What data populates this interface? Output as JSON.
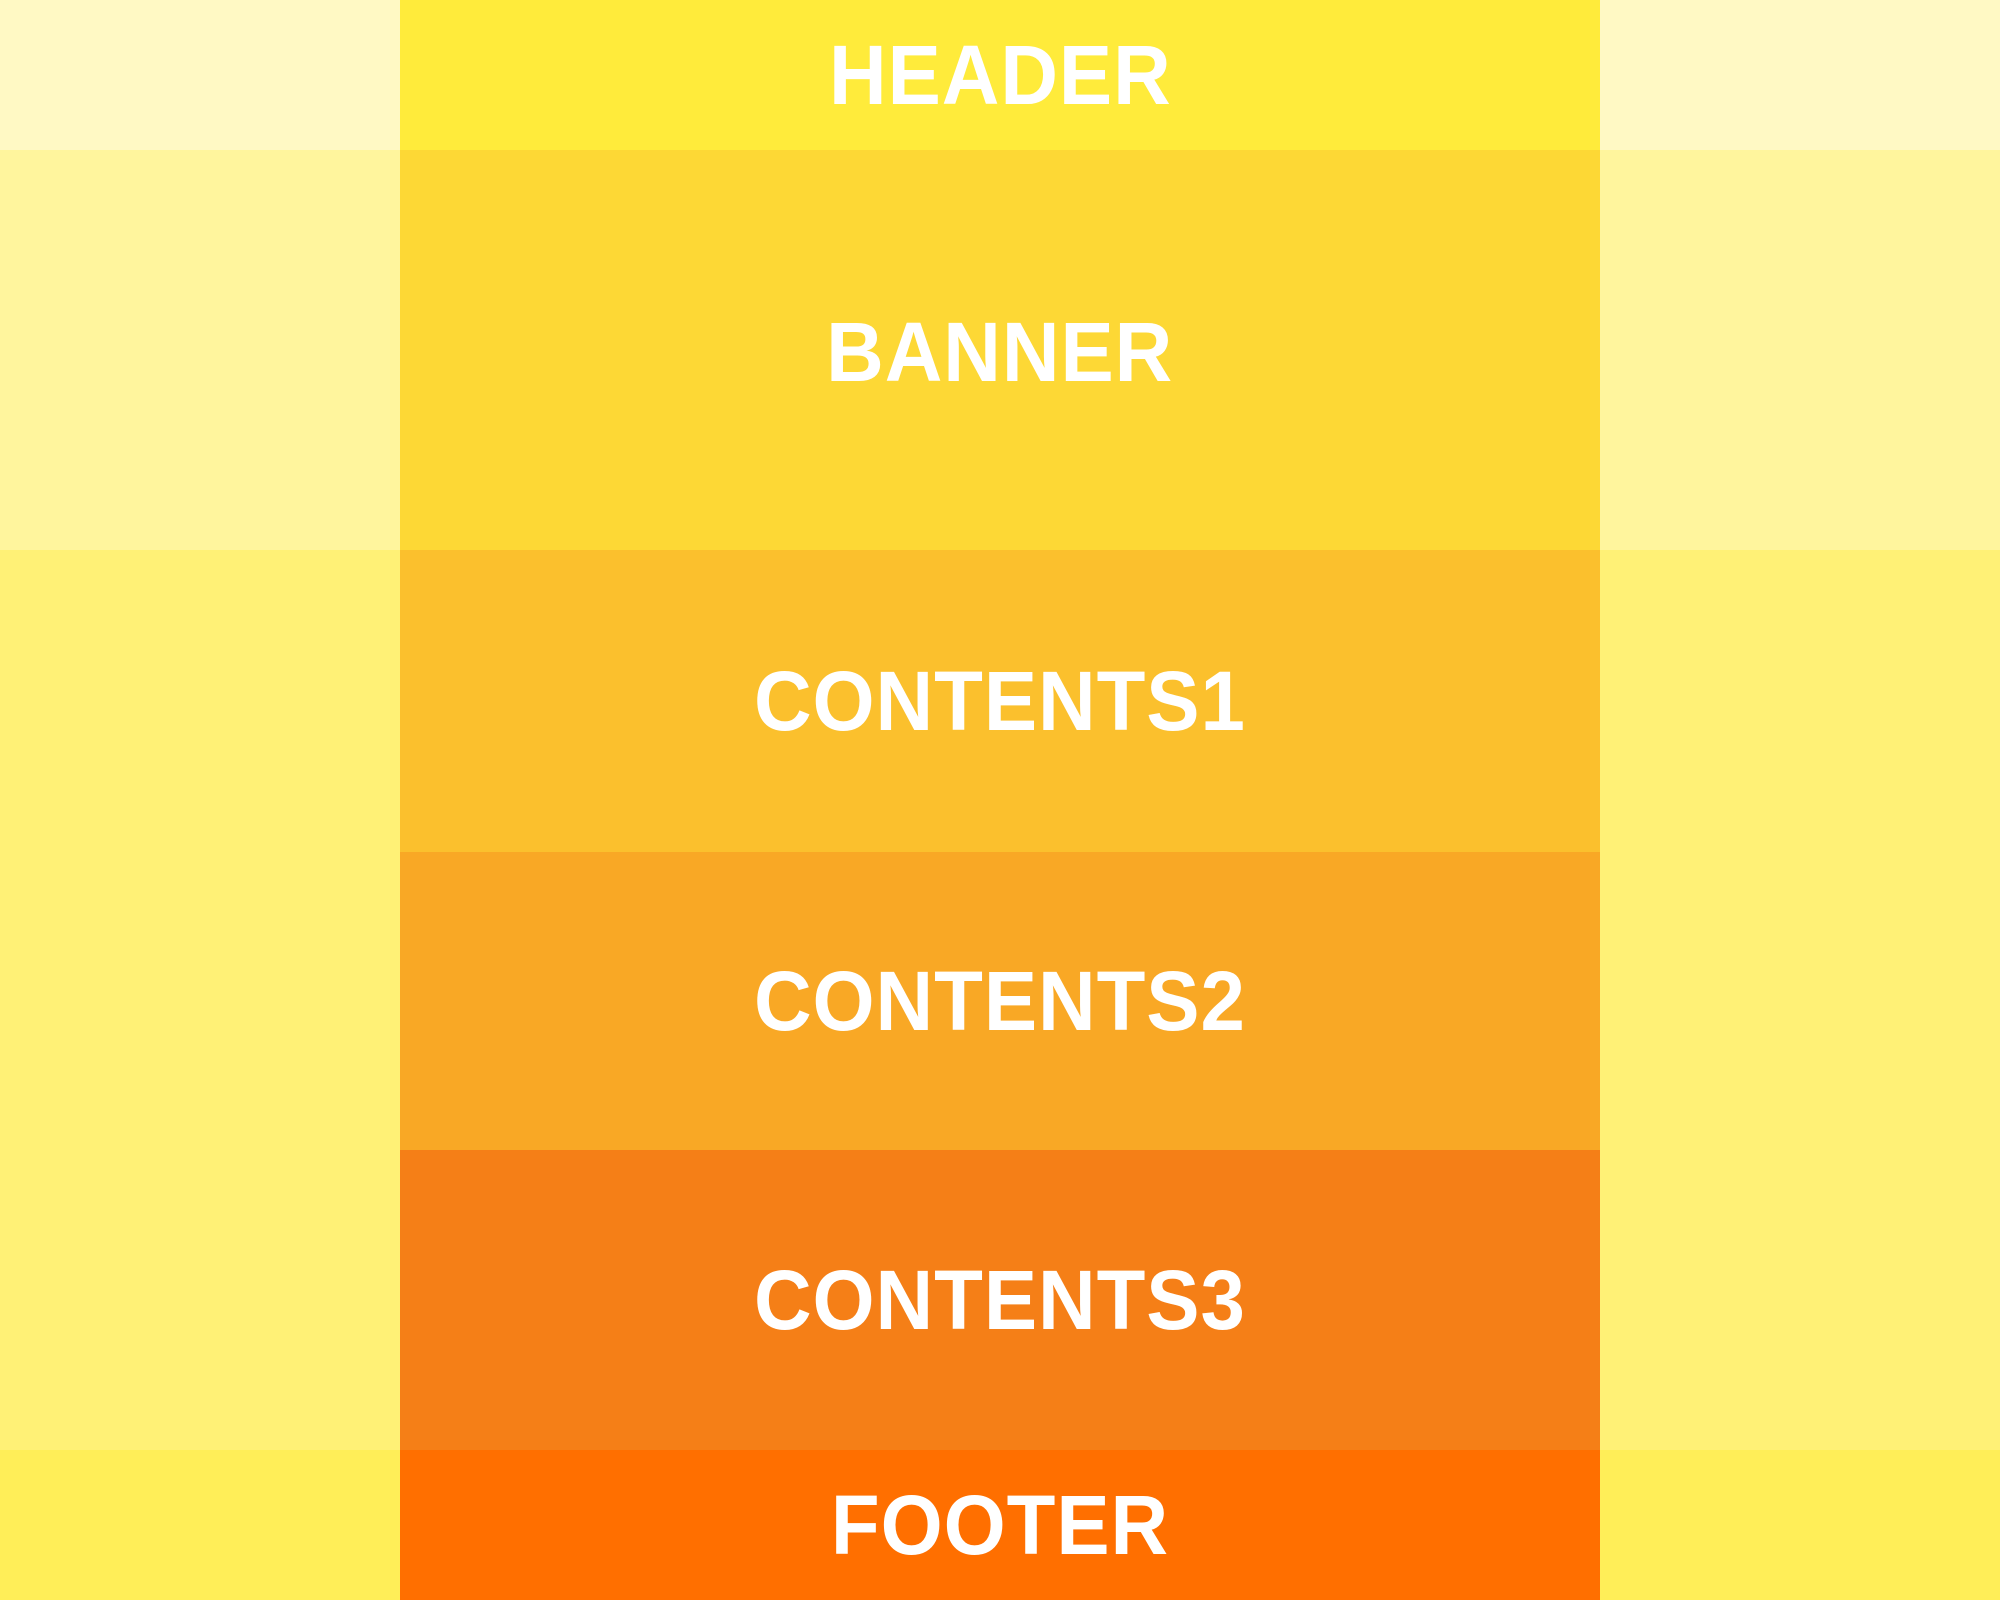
{
  "diagram": {
    "sections": {
      "header": {
        "label": "HEADER",
        "color": "#ffeb3b"
      },
      "banner": {
        "label": "BANNER",
        "color": "#fdd835"
      },
      "contents1": {
        "label": "CONTENTS1",
        "color": "#fbc02d"
      },
      "contents2": {
        "label": "CONTENTS2",
        "color": "#f9a825"
      },
      "contents3": {
        "label": "CONTENTS3",
        "color": "#f57f17"
      },
      "footer": {
        "label": "FOOTER",
        "color": "#ff6f00"
      }
    },
    "side_colors": {
      "header_row": "#fff9c4",
      "banner_row": "#fff59d",
      "contents_rows": "#fff176",
      "footer_row": "#ffee58"
    }
  }
}
